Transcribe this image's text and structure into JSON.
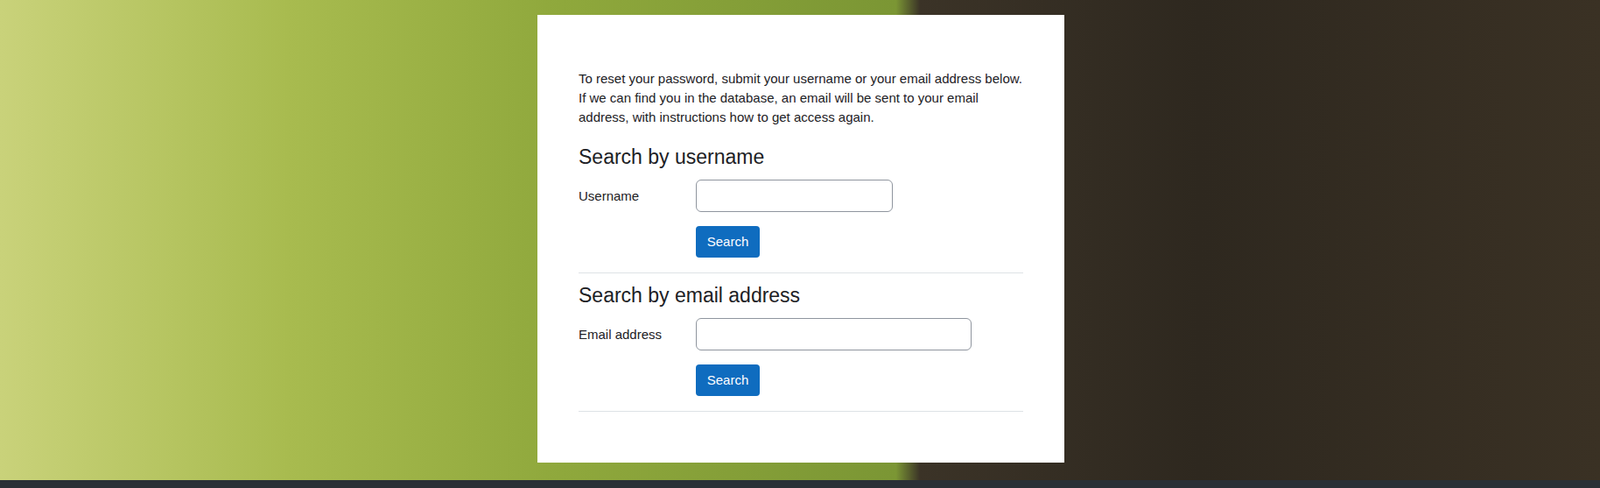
{
  "intro": "To reset your password, submit your username or your email address below. If we can find you in the database, an email will be sent to your email address, with instructions how to get access again.",
  "sections": [
    {
      "heading": "Search by username",
      "label": "Username",
      "kind": "short",
      "button": "Search"
    },
    {
      "heading": "Search by email address",
      "label": "Email address",
      "kind": "long",
      "button": "Search"
    }
  ]
}
